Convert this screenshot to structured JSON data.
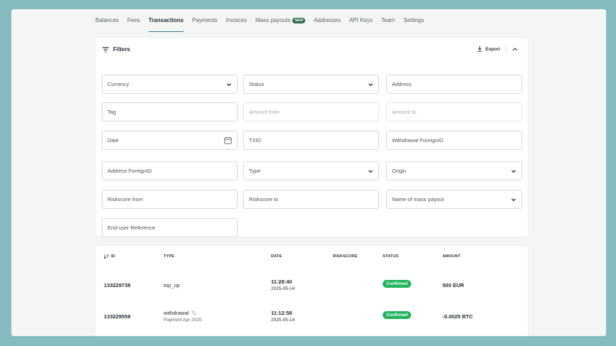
{
  "nav": {
    "tabs": [
      {
        "label": "Balances"
      },
      {
        "label": "Fees"
      },
      {
        "label": "Transactions"
      },
      {
        "label": "Payments"
      },
      {
        "label": "Invoices"
      },
      {
        "label": "Mass payouts",
        "badge": "NEW"
      },
      {
        "label": "Addresses"
      },
      {
        "label": "API Keys"
      },
      {
        "label": "Team"
      },
      {
        "label": "Settings"
      }
    ],
    "active_tab": "Transactions"
  },
  "filters": {
    "title": "Filters",
    "export_label": "Export",
    "fields": {
      "currency": "Currency",
      "status": "Status",
      "address": "Address",
      "tag": "Tag",
      "amount_from": "Amount from",
      "amount_to": "Amount to",
      "date": "Date",
      "txid": "TXID",
      "withdrawal_foreign_id": "Withdrawal ForeignID",
      "address_foreign_id": "Address ForeignID",
      "type": "Type",
      "origin": "Origin",
      "riskscore_from": "Riskscore from",
      "riskscore_to": "Riskscore to",
      "mass_payout_name": "Name of mass payout",
      "end_user_reference": "End-user Reference"
    }
  },
  "table": {
    "headers": {
      "id": "ID",
      "type": "TYPE",
      "date": "DATE",
      "riskscore": "RISKSCORE",
      "status": "STATUS",
      "amount": "AMOUNT"
    },
    "rows": [
      {
        "id": "133229738",
        "type": "top_up",
        "type_sub": "",
        "time": "11:28:40",
        "date": "2025-05-14",
        "status": "Confirmed",
        "amount": "500 EUR"
      },
      {
        "id": "133229559",
        "type": "withdrawal",
        "type_sub": "Payment Apr 2025",
        "time": "11:12:58",
        "date": "2025-05-14",
        "status": "Confirmed",
        "amount": "-0.0025 BTC"
      }
    ]
  },
  "colors": {
    "background": "#86bcc0",
    "accent": "#2f7f7b",
    "confirmed": "#21b35e",
    "new_badge": "#2d6b4b"
  }
}
